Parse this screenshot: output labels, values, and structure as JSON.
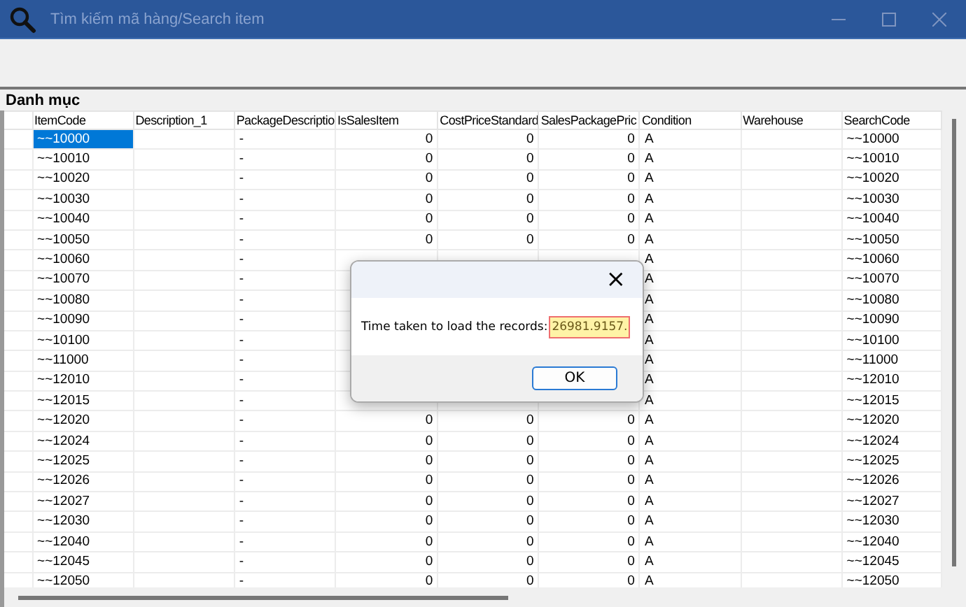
{
  "window": {
    "search_placeholder": "Tìm kiếm mã hàng/Search item"
  },
  "section_label": "Danh mục",
  "table": {
    "columns": [
      {
        "label": "ItemCode",
        "kind": "text"
      },
      {
        "label": "Description_1",
        "kind": "text"
      },
      {
        "label": "PackageDescriptio",
        "kind": "text"
      },
      {
        "label": "IsSalesItem",
        "kind": "number"
      },
      {
        "label": "CostPriceStandard",
        "kind": "number"
      },
      {
        "label": "SalesPackagePric",
        "kind": "number"
      },
      {
        "label": "Condition",
        "kind": "text"
      },
      {
        "label": "Warehouse",
        "kind": "text"
      },
      {
        "label": "SearchCode",
        "kind": "text"
      }
    ],
    "rows": [
      {
        "selected": true,
        "cells": [
          "~~10000",
          null,
          "-",
          "0",
          "0",
          "0",
          "A",
          null,
          "~~10000"
        ]
      },
      {
        "selected": false,
        "cells": [
          "~~10010",
          null,
          "-",
          "0",
          "0",
          "0",
          "A",
          null,
          "~~10010"
        ]
      },
      {
        "selected": false,
        "cells": [
          "~~10020",
          null,
          "-",
          "0",
          "0",
          "0",
          "A",
          null,
          "~~10020"
        ]
      },
      {
        "selected": false,
        "cells": [
          "~~10030",
          null,
          "-",
          "0",
          "0",
          "0",
          "A",
          null,
          "~~10030"
        ]
      },
      {
        "selected": false,
        "cells": [
          "~~10040",
          null,
          "-",
          "0",
          "0",
          "0",
          "A",
          null,
          "~~10040"
        ]
      },
      {
        "selected": false,
        "cells": [
          "~~10050",
          null,
          "-",
          "0",
          "0",
          "0",
          "A",
          null,
          "~~10050"
        ]
      },
      {
        "selected": false,
        "cells": [
          "~~10060",
          null,
          "-",
          null,
          null,
          null,
          "A",
          null,
          "~~10060"
        ]
      },
      {
        "selected": false,
        "cells": [
          "~~10070",
          null,
          "-",
          null,
          null,
          null,
          "A",
          null,
          "~~10070"
        ]
      },
      {
        "selected": false,
        "cells": [
          "~~10080",
          null,
          "-",
          null,
          null,
          null,
          "A",
          null,
          "~~10080"
        ]
      },
      {
        "selected": false,
        "cells": [
          "~~10090",
          null,
          "-",
          null,
          null,
          null,
          "A",
          null,
          "~~10090"
        ]
      },
      {
        "selected": false,
        "cells": [
          "~~10100",
          null,
          "-",
          null,
          null,
          null,
          "A",
          null,
          "~~10100"
        ]
      },
      {
        "selected": false,
        "cells": [
          "~~11000",
          null,
          "-",
          null,
          null,
          null,
          "A",
          null,
          "~~11000"
        ]
      },
      {
        "selected": false,
        "cells": [
          "~~12010",
          null,
          "-",
          null,
          null,
          null,
          "A",
          null,
          "~~12010"
        ]
      },
      {
        "selected": false,
        "cells": [
          "~~12015",
          null,
          "-",
          null,
          null,
          null,
          "A",
          null,
          "~~12015"
        ]
      },
      {
        "selected": false,
        "cells": [
          "~~12020",
          null,
          "-",
          "0",
          "0",
          "0",
          "A",
          null,
          "~~12020"
        ]
      },
      {
        "selected": false,
        "cells": [
          "~~12024",
          null,
          "-",
          "0",
          "0",
          "0",
          "A",
          null,
          "~~12024"
        ]
      },
      {
        "selected": false,
        "cells": [
          "~~12025",
          null,
          "-",
          "0",
          "0",
          "0",
          "A",
          null,
          "~~12025"
        ]
      },
      {
        "selected": false,
        "cells": [
          "~~12026",
          null,
          "-",
          "0",
          "0",
          "0",
          "A",
          null,
          "~~12026"
        ]
      },
      {
        "selected": false,
        "cells": [
          "~~12027",
          null,
          "-",
          "0",
          "0",
          "0",
          "A",
          null,
          "~~12027"
        ]
      },
      {
        "selected": false,
        "cells": [
          "~~12030",
          null,
          "-",
          "0",
          "0",
          "0",
          "A",
          null,
          "~~12030"
        ]
      },
      {
        "selected": false,
        "cells": [
          "~~12040",
          null,
          "-",
          "0",
          "0",
          "0",
          "A",
          null,
          "~~12040"
        ]
      },
      {
        "selected": false,
        "cells": [
          "~~12045",
          null,
          "-",
          "0",
          "0",
          "0",
          "A",
          null,
          "~~12045"
        ]
      },
      {
        "selected": false,
        "cells": [
          "~~12050",
          null,
          "-",
          "0",
          "0",
          "0",
          "A",
          null,
          "~~12050"
        ]
      }
    ]
  },
  "dialog": {
    "close": "×",
    "message": "Time taken to load the records:",
    "value": "26981.9157.",
    "value_highlighted": true,
    "ok_button": "OK"
  }
}
